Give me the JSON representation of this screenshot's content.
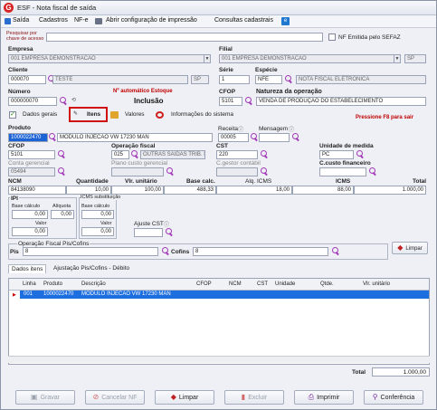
{
  "window": {
    "title": "ESF - Nota fiscal de saída",
    "logo_letter": "G"
  },
  "menu": {
    "items": [
      "Saída",
      "Cadastros",
      "NF-e",
      "Abrir configuração de impressão",
      "Consultas cadastrais"
    ]
  },
  "search": {
    "label": "Pesquisar por chave de acesso",
    "value": ""
  },
  "nf_emitida": {
    "label": "NF Emitida pelo SEFAZ",
    "checked": false
  },
  "empresa": {
    "label": "Empresa",
    "value": "001 EMPRESA DEMONSTRACAO"
  },
  "filial": {
    "label": "Filial",
    "value": "001 EMPRESA DEMONSTRACAO",
    "uf": "SP"
  },
  "cliente": {
    "label": "Cliente",
    "code": "000070",
    "name": "TESTE",
    "uf": "SP"
  },
  "serie": {
    "label": "Série",
    "value": "1"
  },
  "especie": {
    "label": "Espécie",
    "code": "NFE",
    "description": "NOTA FISCAL ELETRONICA"
  },
  "numero": {
    "label": "Número",
    "value": "000000070",
    "auto_note": "Nº automático Estoque",
    "status": "Inclusão"
  },
  "cfop": {
    "label": "CFOP",
    "value": "5101"
  },
  "natureza": {
    "label": "Natureza da operação",
    "value": "VENDA DE PRODUÇÃO DO ESTABELECIMENTO"
  },
  "tabs": {
    "dados_gerais": "Dados gerais",
    "itens": "Itens",
    "valores": "Valores",
    "informacoes": "Informações do sistema",
    "f8_hint": "Pressione F8 para sair"
  },
  "item": {
    "produto_label": "Produto",
    "produto_code": "1000022470",
    "produto_desc": "MODULO INJECAO VW 17230 MAN",
    "receita_label": "Receita",
    "receita_value": "00005",
    "mensagem_label": "Mensagem",
    "cfop_label": "CFOP",
    "cfop_value": "5101",
    "op_fiscal_label": "Operação fiscal",
    "op_fiscal_code": "025",
    "op_fiscal_desc": "OUTRAS SAIDAS TRIB. P",
    "cst_label": "CST",
    "cst_value": "220",
    "unidade_label": "Unidade de medida",
    "unidade_value": "PC",
    "conta_gerencial_label": "Conta gerencial",
    "conta_gerencial_value": "05494",
    "plano_custo_label": "Plano custo gerencial",
    "c_contabil_label": "C.gestor contábil",
    "c_custo_label": "C.custo financeiro",
    "ncm_label": "NCM",
    "ncm_value": "84138090",
    "quantidade_label": "Quantidade",
    "quantidade_value": "10,00",
    "vlr_unitario_label": "Vlr. unitário",
    "vlr_unitario_value": "100,00",
    "base_calc_label": "Base calc.",
    "base_calc_value": "488,33",
    "aliq_icms_label": "Alq. ICMS",
    "aliq_icms_value": "18,00",
    "icms_label": "ICMS",
    "icms_value": "88,00",
    "total_label": "Total",
    "total_value": "1.000,00",
    "ipi_label": "IPI",
    "base_ipi_label": "Base cálculo",
    "base_ipi_value": "0,00",
    "aliq_ipi_label": "Alíquota",
    "aliq_ipi_value": "0,00",
    "valor_ipi_label": "Valor",
    "valor_ipi_value": "0,00",
    "icms_st_label": "ICMS substituição",
    "base_st_label": "Base cálculo",
    "base_st_value": "0,00",
    "valor_st_label": "Valor",
    "valor_st_value": "0,00",
    "ajuste_label": "Ajuste CST",
    "op_pis_label": "Operação Fiscal Pis/Cofins",
    "pis_label": "Pis",
    "pis_value": "8",
    "cofins_label": "Cofins",
    "cofins_value": "8",
    "limpar_label": "Limpar"
  },
  "subtabs": {
    "dados_itens": "Dados itens",
    "ajustes": "Ajustação Pis/Cofins - Débito"
  },
  "grid": {
    "columns": [
      "Linha",
      "Produto",
      "Descrição",
      "CFOP",
      "NCM",
      "CST",
      "Unidade",
      "Qtde.",
      "Vlr. unitário"
    ],
    "rows": [
      {
        "linha": "001",
        "produto": "1000022470",
        "descricao": "MODULO INJECAO VW 17230 MAN",
        "cfop": "",
        "ncm": "",
        "cst": "",
        "unidade": "",
        "qtde": "",
        "vlr": ""
      }
    ],
    "total_label": "Total",
    "total_value": "1.000,00"
  },
  "buttons": {
    "gravar": "Gravar",
    "cancelar": "Cancelar NF",
    "limpar": "Limpar",
    "excluir": "Excluir",
    "imprimir": "Imprimir",
    "conferencia": "Conferência"
  }
}
